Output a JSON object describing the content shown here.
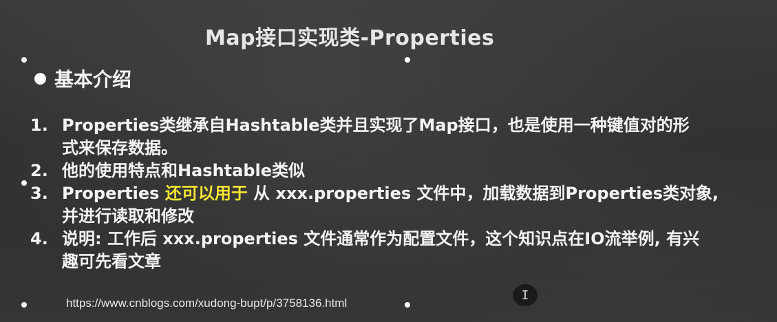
{
  "slide": {
    "title": "Map接口实现类-Properties"
  },
  "section": {
    "heading": "基本介绍"
  },
  "items": [
    {
      "number": "1.",
      "lines": [
        "Properties类继承自Hashtable类并且实现了Map接口，也是使用一种键值对的形",
        "式来保存数据。"
      ]
    },
    {
      "number": "2.",
      "lines": [
        "他的使用特点和Hashtable类似"
      ]
    },
    {
      "number": "3.",
      "prefix": "Properties ",
      "highlight": "还可以用于",
      "suffix": " 从 xxx.properties 文件中，加载数据到Properties类对象,",
      "line2": "并进行读取和修改"
    },
    {
      "number": "4.",
      "lines": [
        "说明: 工作后  xxx.properties 文件通常作为配置文件，这个知识点在IO流举例, 有兴",
        "趣可先看文章"
      ]
    }
  ],
  "link": {
    "url": "https://www.cnblogs.com/xudong-bupt/p/3758136.html"
  },
  "cursor": {
    "glyph": "I"
  },
  "colors": {
    "highlight": "#f5e732",
    "text": "#f4f4f4",
    "background": "#333333"
  }
}
